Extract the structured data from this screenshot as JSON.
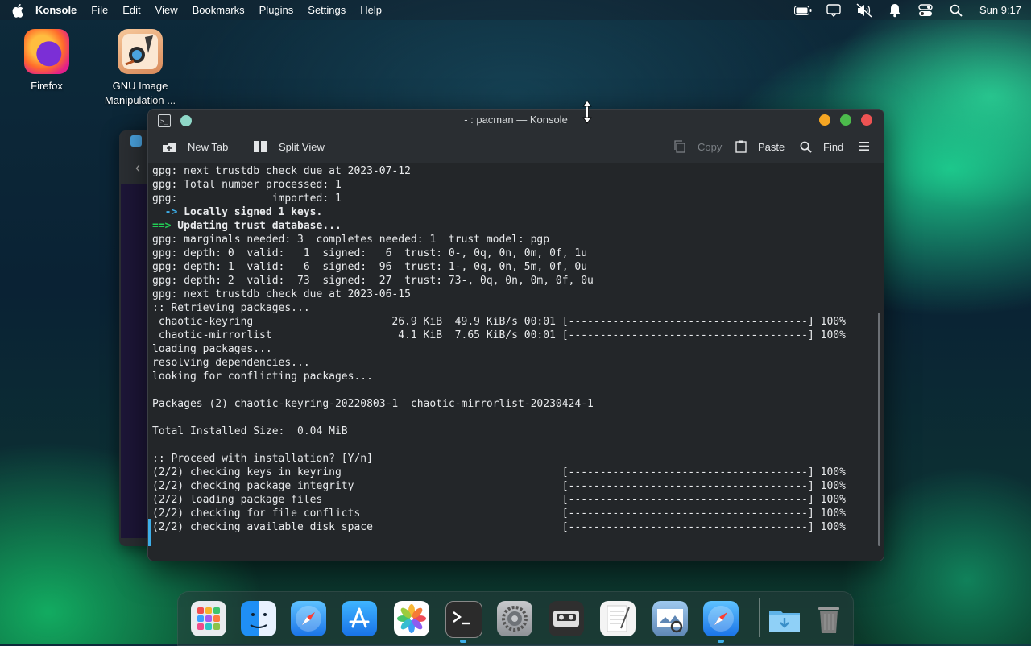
{
  "menubar": {
    "app_name": "Konsole",
    "menus": [
      "File",
      "Edit",
      "View",
      "Bookmarks",
      "Plugins",
      "Settings",
      "Help"
    ],
    "clock": "Sun 9:17"
  },
  "desktop_icons": [
    {
      "label": "Firefox"
    },
    {
      "label": "GNU Image Manipulation ..."
    }
  ],
  "window": {
    "title": "- : pacman — Konsole",
    "toolbar": {
      "new_tab": "New Tab",
      "split_view": "Split View",
      "copy": "Copy",
      "paste": "Paste",
      "find": "Find"
    }
  },
  "terminal": {
    "lines": [
      "gpg: next trustdb check due at 2023-07-12",
      "gpg: Total number processed: 1",
      "gpg:               imported: 1",
      "  -> Locally signed 1 keys.",
      "==> Updating trust database...",
      "gpg: marginals needed: 3  completes needed: 1  trust model: pgp",
      "gpg: depth: 0  valid:   1  signed:   6  trust: 0-, 0q, 0n, 0m, 0f, 1u",
      "gpg: depth: 1  valid:   6  signed:  96  trust: 1-, 0q, 0n, 5m, 0f, 0u",
      "gpg: depth: 2  valid:  73  signed:  27  trust: 73-, 0q, 0n, 0m, 0f, 0u",
      "gpg: next trustdb check due at 2023-06-15",
      ":: Retrieving packages...",
      " chaotic-keyring                      26.9 KiB  49.9 KiB/s 00:01 [--------------------------------------] 100%",
      " chaotic-mirrorlist                    4.1 KiB  7.65 KiB/s 00:01 [--------------------------------------] 100%",
      "loading packages...",
      "resolving dependencies...",
      "looking for conflicting packages...",
      "",
      "Packages (2) chaotic-keyring-20220803-1  chaotic-mirrorlist-20230424-1",
      "",
      "Total Installed Size:  0.04 MiB",
      "",
      ":: Proceed with installation? [Y/n]",
      "(2/2) checking keys in keyring                                   [--------------------------------------] 100%",
      "(2/2) checking package integrity                                 [--------------------------------------] 100%",
      "(2/2) loading package files                                      [--------------------------------------] 100%",
      "(2/2) checking for file conflicts                                [--------------------------------------] 100%",
      "(2/2) checking available disk space                              [--------------------------------------] 100%"
    ],
    "locally_signed_arrow": "  ->",
    "locally_signed_text": " Locally signed 1 keys.",
    "updating_arrow": "==>",
    "updating_text": " Updating trust database..."
  },
  "dock": {
    "items": [
      "launchpad-icon",
      "finder-icon",
      "safari-icon",
      "app-store-icon",
      "photos-icon",
      "terminal-icon",
      "system-settings-icon",
      "cassette-icon",
      "textedit-icon",
      "preview-icon",
      "safari-icon",
      "downloads-folder-icon",
      "trash-icon"
    ]
  },
  "colors": {
    "accent": "#3daee9",
    "close": "#ed5353",
    "maximize": "#4cbb4c",
    "minimize": "#f5a623"
  }
}
